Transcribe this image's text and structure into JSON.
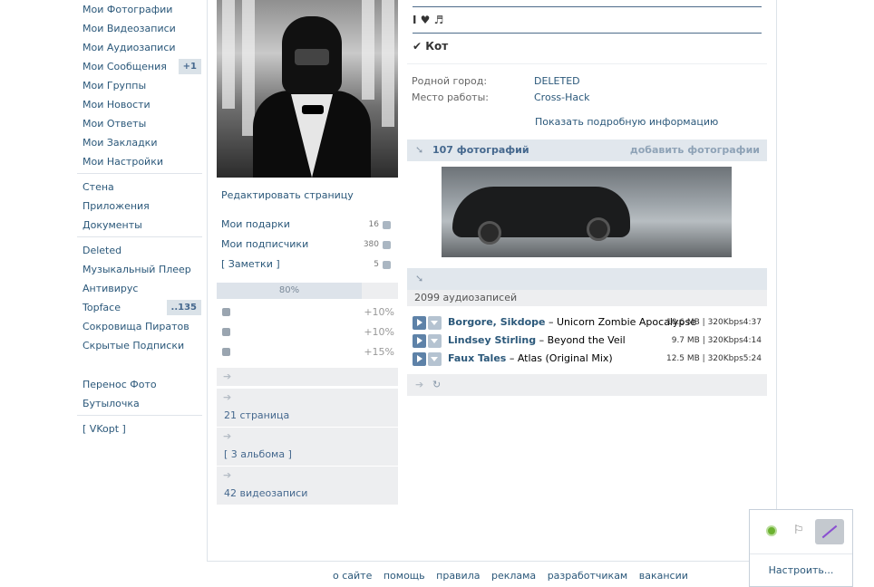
{
  "left_menu": {
    "items": [
      {
        "label": "Мои Фотографии"
      },
      {
        "label": "Мои Видеозаписи"
      },
      {
        "label": "Мои Аудиозаписи"
      },
      {
        "label": "Мои Сообщения",
        "badge": "+1"
      },
      {
        "label": "Мои Группы"
      },
      {
        "label": "Мои Новости"
      },
      {
        "label": "Мои Ответы"
      },
      {
        "label": "Мои Закладки"
      },
      {
        "label": "Мои Настройки"
      },
      {
        "label": "Стена"
      },
      {
        "label": "Приложения"
      },
      {
        "label": "Документы"
      },
      {
        "label": "Deleted"
      },
      {
        "label": "Музыкальный Плеер"
      },
      {
        "label": "Антивирус"
      },
      {
        "label": "Topface",
        "badge": "..135"
      },
      {
        "label": "Сокровища Пиратов"
      },
      {
        "label": "Скрытые Подписки"
      },
      {
        "label": "Перенос Фото"
      },
      {
        "label": "Бутылочка"
      },
      {
        "label": "[ VKopt ]"
      }
    ]
  },
  "profile": {
    "edit_page": "Редактировать страницу",
    "counters": [
      {
        "label": "Мои подарки",
        "count": "16",
        "icon": "gift-icon"
      },
      {
        "label": "Мои подписчики",
        "count": "380",
        "icon": "subscribers-icon"
      },
      {
        "label": "[ Заметки ]",
        "count": "5",
        "icon": "notes-icon"
      }
    ],
    "completeness": {
      "label": "80%",
      "value": 0.8
    },
    "bonuses": [
      {
        "icon": "briefcase-icon",
        "value": "+10%"
      },
      {
        "icon": "phone-icon",
        "value": "+10%"
      },
      {
        "icon": "people-icon",
        "value": "+15%"
      }
    ],
    "side_blocks": [
      {
        "text": ""
      },
      {
        "text": "21 страница"
      },
      {
        "text": "[ 3 альбома ]"
      },
      {
        "text": "42 видеозаписи"
      }
    ]
  },
  "right": {
    "status1": "I ♥ ♬",
    "status2": "✔ Кот",
    "info": [
      {
        "label": "Родной город:",
        "value": "DELETED"
      },
      {
        "label": "Место работы:",
        "value": "Cross-Hack"
      }
    ],
    "more_info": "Показать подробную информацию",
    "photos": {
      "title": "107 фотографий",
      "action": "добавить фотографии"
    },
    "audio": {
      "count": "2099 аудиозаписей",
      "tracks": [
        {
          "artist": "Borgore, Sikdope",
          "title": "Unicorn Zombie Apocalypse",
          "meta": "10.6 MB | 320Kbps",
          "duration": "4:37"
        },
        {
          "artist": "Lindsey Stirling",
          "title": "Beyond the Veil",
          "meta": "9.7 MB | 320Kbps",
          "duration": "4:14"
        },
        {
          "artist": "Faux Tales",
          "title": "Atlas (Original Mix)",
          "meta": "12.5 MB | 320Kbps",
          "duration": "5:24"
        }
      ]
    }
  },
  "footer": {
    "links": [
      "о сайте",
      "помощь",
      "правила",
      "реклама",
      "разработчикам",
      "вакансии"
    ]
  },
  "widget": {
    "configure": "Настроить..."
  }
}
